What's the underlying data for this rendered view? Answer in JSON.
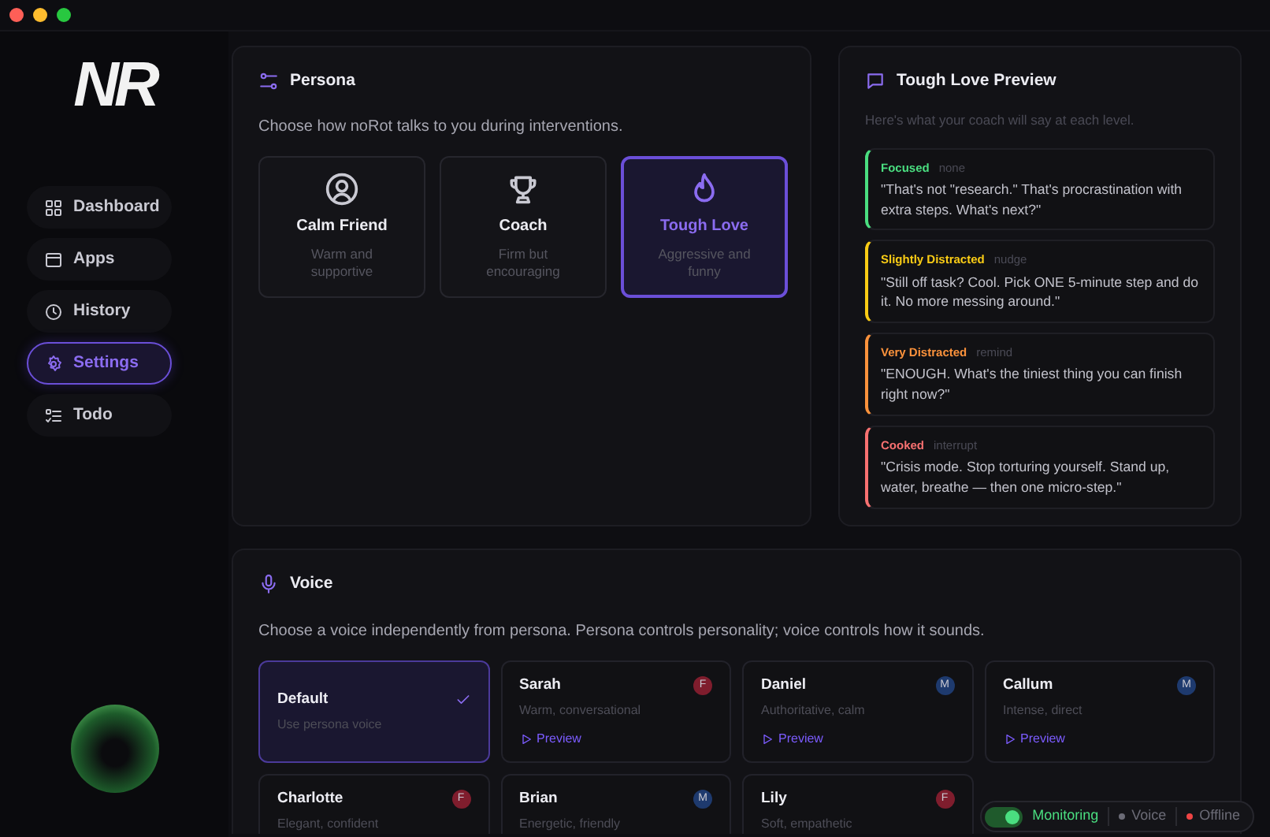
{
  "logo": "NR",
  "sidebar": {
    "items": [
      {
        "label": "Dashboard",
        "selected": false
      },
      {
        "label": "Apps",
        "selected": false
      },
      {
        "label": "History",
        "selected": false
      },
      {
        "label": "Settings",
        "selected": true
      },
      {
        "label": "Todo",
        "selected": false
      }
    ]
  },
  "persona": {
    "title": "Persona",
    "description": "Choose how noRot talks to you during interventions.",
    "options": [
      {
        "name": "Calm Friend",
        "detail": "Warm and supportive",
        "selected": false
      },
      {
        "name": "Coach",
        "detail": "Firm but encouraging",
        "selected": false
      },
      {
        "name": "Tough Love",
        "detail": "Aggressive and funny",
        "selected": true
      }
    ]
  },
  "preview": {
    "title": "Tough Love Preview",
    "subtitle": "Here's what your coach will say at each level.",
    "levels": [
      {
        "level": "Focused",
        "mode": "none",
        "quote": "\"That's not \"research.\" That's procrastination with extra steps. What's next?\"",
        "color": "#4ade80"
      },
      {
        "level": "Slightly Distracted",
        "mode": "nudge",
        "quote": "\"Still off task? Cool. Pick ONE 5-minute step and do it. No more messing around.\"",
        "color": "#facc15"
      },
      {
        "level": "Very Distracted",
        "mode": "remind",
        "quote": "\"ENOUGH. What's the tiniest thing you can finish right now?\"",
        "color": "#fb923c"
      },
      {
        "level": "Cooked",
        "mode": "interrupt",
        "quote": "\"Crisis mode. Stop torturing yourself. Stand up, water, breathe — then one micro-step.\"",
        "color": "#f87171"
      }
    ]
  },
  "voice": {
    "title": "Voice",
    "description": "Choose a voice independently from persona. Persona controls personality; voice controls how it sounds.",
    "voices": [
      {
        "name": "Default",
        "detail": "Use persona voice",
        "selected": true
      },
      {
        "name": "Sarah",
        "detail": "Warm, conversational",
        "badge": "F",
        "color": "#7f1d2d",
        "preview": "Preview",
        "selected": false
      },
      {
        "name": "Daniel",
        "detail": "Authoritative, calm",
        "badge": "M",
        "color": "#1e3a6e",
        "preview": "Preview",
        "selected": false
      },
      {
        "name": "Callum",
        "detail": "Intense, direct",
        "badge": "M",
        "color": "#1e3a6e",
        "preview": "Preview",
        "selected": false
      },
      {
        "name": "Charlotte",
        "detail": "Elegant, confident",
        "badge": "F",
        "color": "#7f1d2d",
        "selected": false
      },
      {
        "name": "Brian",
        "detail": "Energetic, friendly",
        "badge": "M",
        "color": "#1e3a6e",
        "selected": false
      },
      {
        "name": "Lily",
        "detail": "Soft, empathetic",
        "badge": "F",
        "color": "#7f1d2d",
        "selected": false
      }
    ]
  },
  "status": {
    "monitoring": {
      "label": "Monitoring",
      "on": true
    },
    "indicators": [
      {
        "label": "Voice",
        "color": "#6b6b76"
      },
      {
        "label": "Offline",
        "color": "#ef4444"
      }
    ]
  }
}
